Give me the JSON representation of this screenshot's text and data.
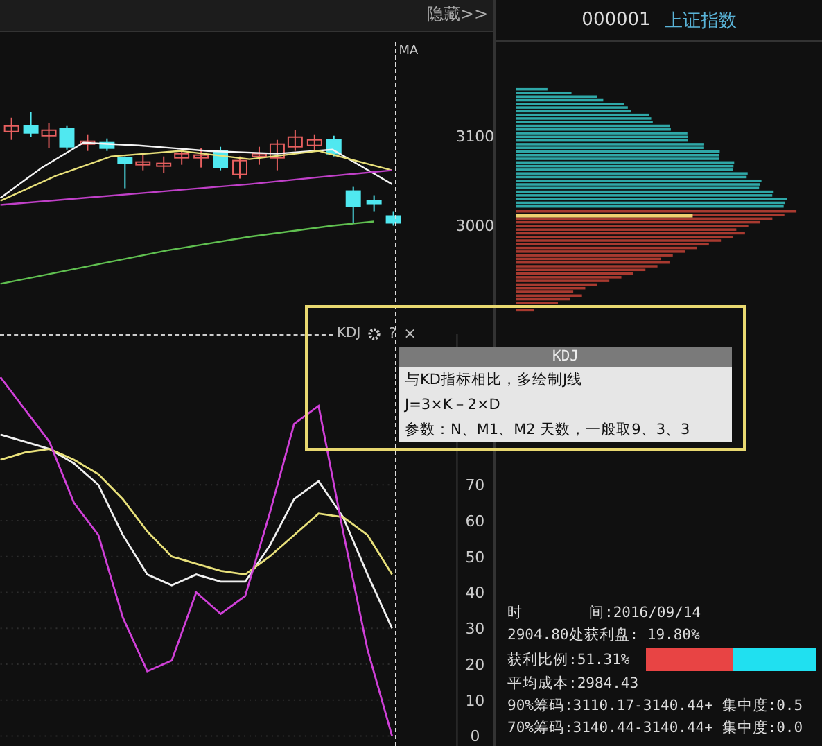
{
  "top_bar": {
    "hide_button": "隐藏>>"
  },
  "security": {
    "code": "000001",
    "name": "上证指数"
  },
  "price_chart": {
    "indicator_label": "MA",
    "price_labels": [
      "3100",
      "3000"
    ]
  },
  "kdj_chart": {
    "label": "KDJ",
    "help": "?",
    "close": "×",
    "chart_data": {
      "type": "line",
      "grid": true,
      "ylim": [
        -3,
        112
      ],
      "yticks": [
        0,
        10,
        20,
        30,
        40,
        50,
        60,
        70
      ],
      "series": [
        {
          "color": "#f0f0f0",
          "values": [
            84,
            82,
            80,
            76,
            70,
            56,
            45,
            42,
            45,
            43,
            43,
            53,
            66,
            71,
            61,
            45,
            30
          ]
        },
        {
          "color": "#e8e07a",
          "values": [
            77,
            79,
            80,
            77,
            73,
            66,
            57,
            50,
            48,
            46,
            45,
            50,
            56,
            62,
            61,
            56,
            45
          ]
        },
        {
          "color": "#d040d8",
          "values": [
            100,
            91,
            82,
            65,
            56,
            33,
            18,
            21,
            40,
            34,
            39,
            62,
            87,
            92,
            57,
            24,
            0
          ]
        }
      ]
    }
  },
  "tooltip": {
    "title": "KDJ",
    "lines": [
      "与KD指标相比，多绘制J线",
      "J=3×K－2×D",
      "参数：N、M1、M2 天数，一般取9、3、3"
    ]
  },
  "chip_info": {
    "time_label": "时",
    "time_value": "间:2016/09/14",
    "profit_line": "2904.80处获利盘: 19.80%",
    "profit_ratio": {
      "label": "获利比例:51.31%",
      "level": 0.51
    },
    "lines": [
      "平均成本:2984.43",
      "90%筹码:3110.17-3140.44+ 集中度:0.5",
      "70%筹码:3140.44-3140.44+ 集中度:0.0"
    ]
  }
}
